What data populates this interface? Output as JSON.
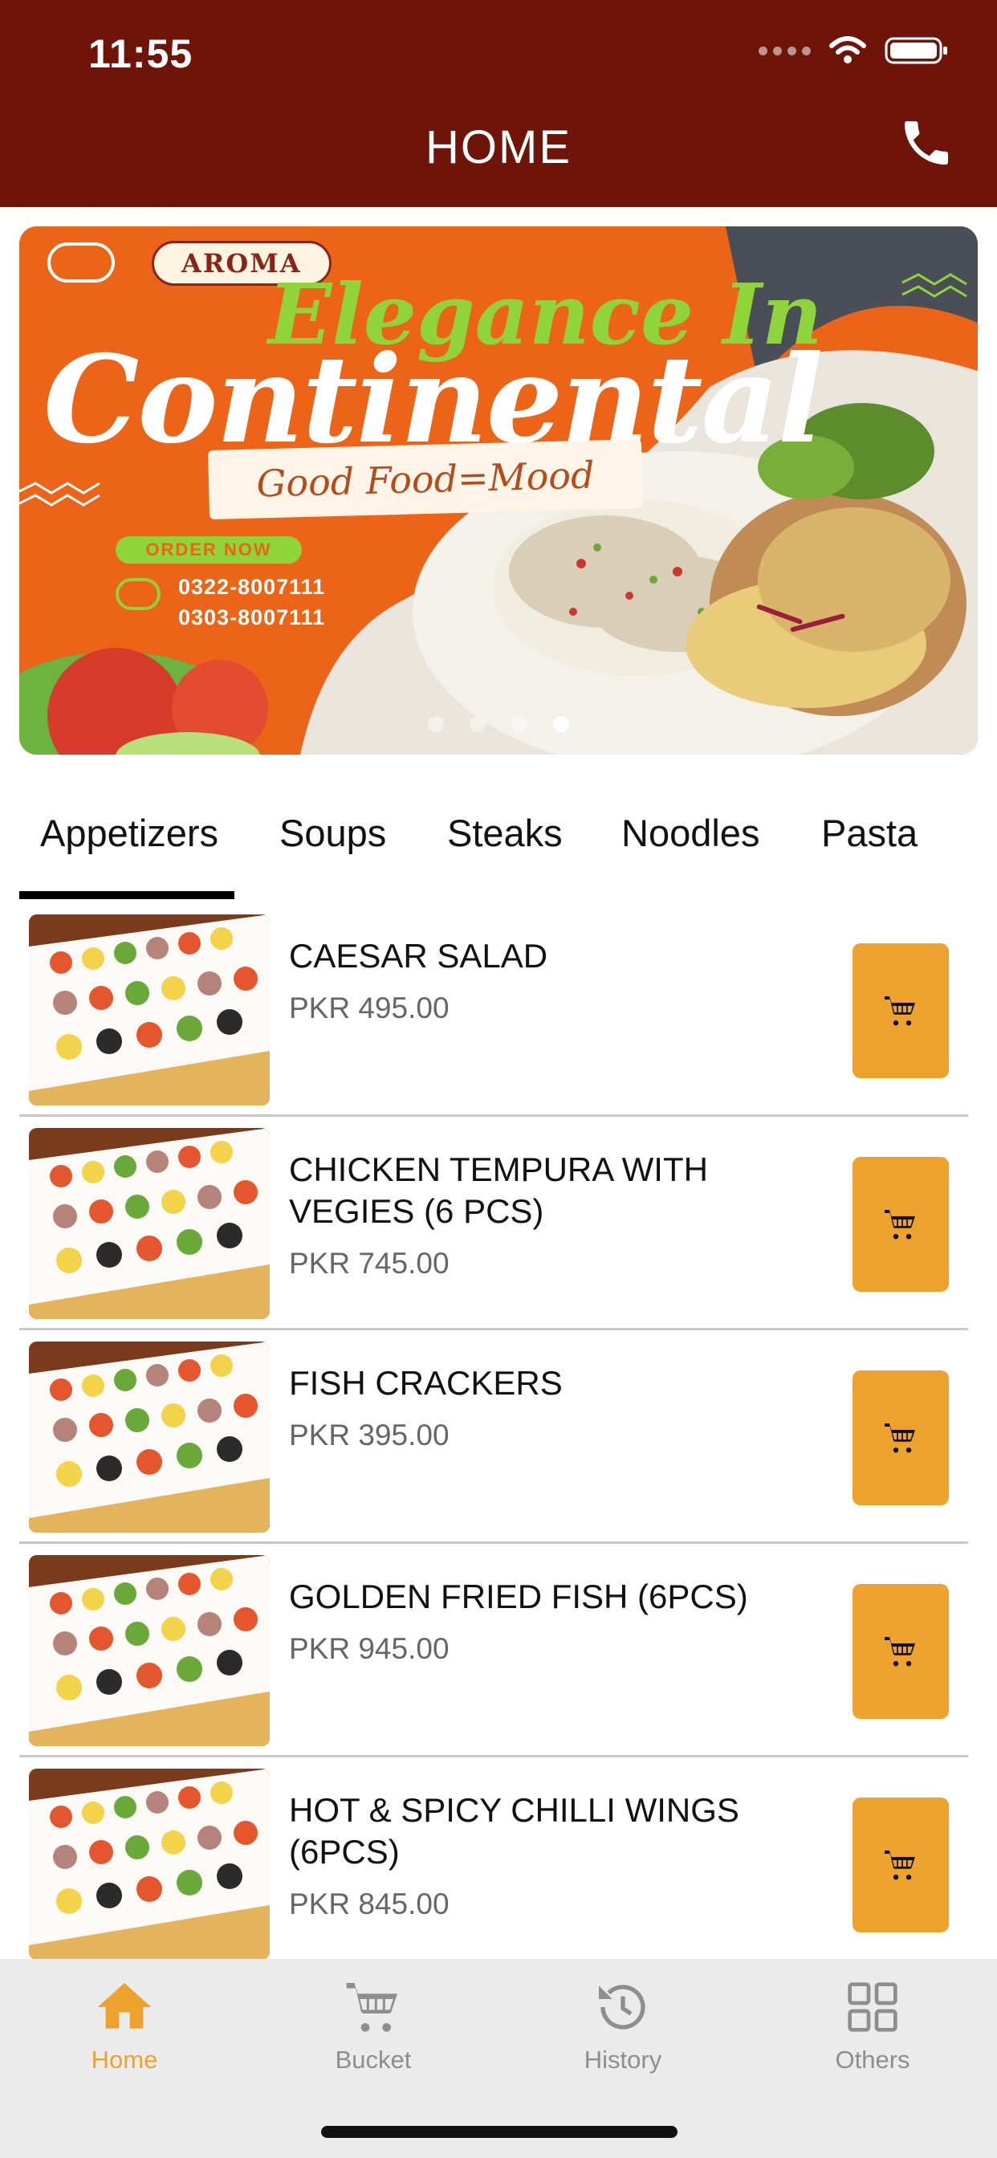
{
  "status_bar": {
    "time": "11:55"
  },
  "header": {
    "title": "HOME"
  },
  "banner": {
    "brand": "AROMA",
    "headline_1": "Elegance In",
    "headline_2": "Continental",
    "tagline": "Good Food=Mood",
    "cta": "ORDER NOW",
    "phones": [
      "0322-8007111",
      "0303-8007111"
    ],
    "slides_total": 4,
    "active_slide": 4
  },
  "tabs": [
    {
      "label": "Appetizers",
      "active": true
    },
    {
      "label": "Soups",
      "active": false
    },
    {
      "label": "Steaks",
      "active": false
    },
    {
      "label": "Noodles",
      "active": false
    },
    {
      "label": "Pasta",
      "active": false
    }
  ],
  "menu_items": [
    {
      "name": "CAESAR SALAD",
      "price": "PKR 495.00"
    },
    {
      "name": "CHICKEN TEMPURA WITH VEGIES (6 PCS)",
      "price": "PKR 745.00"
    },
    {
      "name": "FISH CRACKERS",
      "price": "PKR 395.00"
    },
    {
      "name": "GOLDEN FRIED FISH (6PCS)",
      "price": "PKR 945.00"
    },
    {
      "name": "HOT & SPICY CHILLI WINGS (6PCS)",
      "price": "PKR 845.00"
    }
  ],
  "bottom_nav": [
    {
      "label": "Home",
      "icon": "home-icon",
      "active": true
    },
    {
      "label": "Bucket",
      "icon": "cart-icon",
      "active": false
    },
    {
      "label": "History",
      "icon": "history-icon",
      "active": false
    },
    {
      "label": "Others",
      "icon": "grid-icon",
      "active": false
    }
  ],
  "colors": {
    "header_bg": "#6e1409",
    "accent": "#eca22c",
    "banner_orange": "#ec6418",
    "banner_green": "#8fd43a"
  }
}
